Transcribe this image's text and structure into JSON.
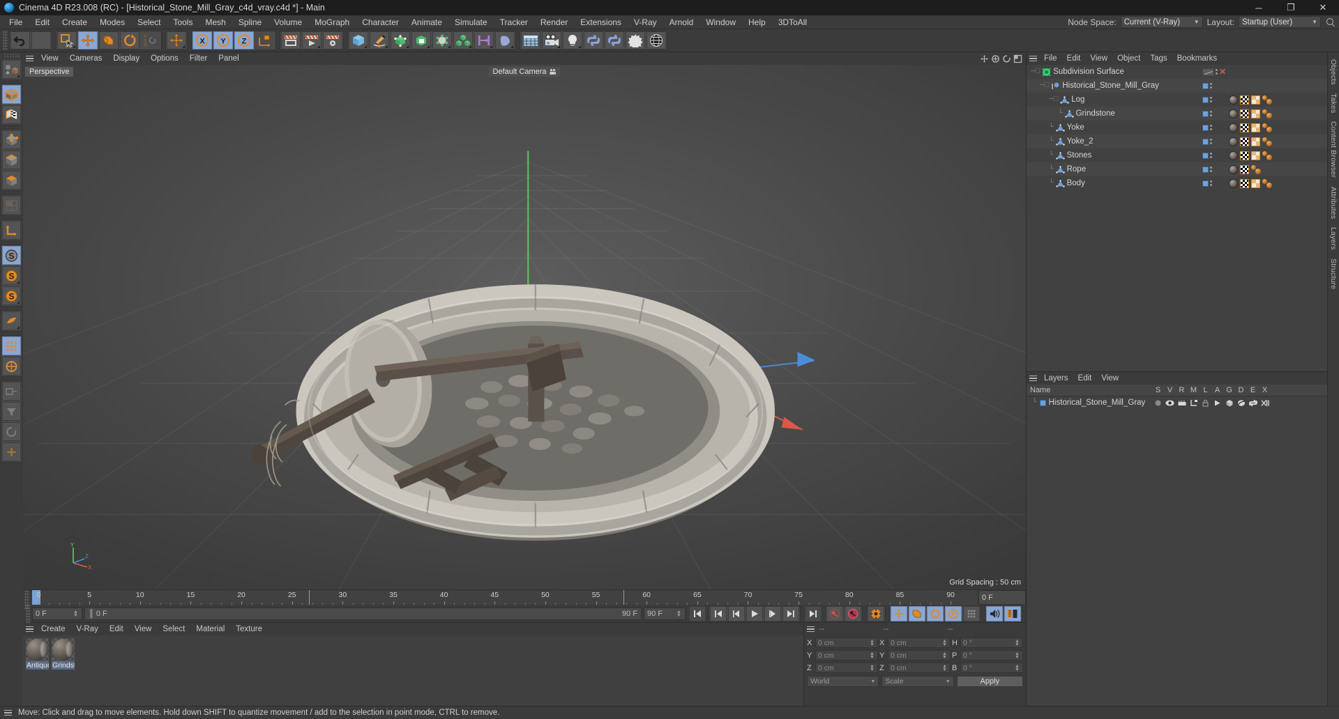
{
  "window": {
    "title": "Cinema 4D R23.008 (RC) - [Historical_Stone_Mill_Gray_c4d_vray.c4d *] - Main",
    "minimize": "─",
    "maximize": "❐",
    "close": "✕"
  },
  "menubar": {
    "items": [
      "File",
      "Edit",
      "Create",
      "Modes",
      "Select",
      "Tools",
      "Mesh",
      "Spline",
      "Volume",
      "MoGraph",
      "Character",
      "Animate",
      "Simulate",
      "Tracker",
      "Render",
      "Extensions",
      "V-Ray",
      "Arnold",
      "Window",
      "Help",
      "3DToAll"
    ],
    "node_space_label": "Node Space:",
    "node_space_value": "Current (V-Ray)",
    "layout_label": "Layout:",
    "layout_value": "Startup (User)"
  },
  "viewport": {
    "menu": [
      "View",
      "Cameras",
      "Display",
      "Options",
      "Filter",
      "Panel"
    ],
    "projection_label": "Perspective",
    "camera_label": "Default Camera",
    "grid_spacing": "Grid Spacing : 50 cm",
    "axis_x": "X",
    "axis_y": "Y",
    "axis_z": "Z"
  },
  "timeline": {
    "ticks": [
      0,
      5,
      10,
      15,
      20,
      25,
      30,
      35,
      40,
      45,
      50,
      55,
      60,
      65,
      70,
      75,
      80,
      85,
      90
    ],
    "current_frame_left": "0 F",
    "track_start": "0 F",
    "track_end": "90 F",
    "range_end": "90 F",
    "right_frame": "0 F"
  },
  "objects": {
    "menu": [
      "File",
      "Edit",
      "View",
      "Object",
      "Tags",
      "Bookmarks"
    ],
    "rows": [
      {
        "name": "Subdivision Surface",
        "indent": 0,
        "icon": "subdivision-icon",
        "tags": [],
        "has_dash": true,
        "has_x": true,
        "swatch": false
      },
      {
        "name": "Historical_Stone_Mill_Gray",
        "indent": 1,
        "icon": "null-object-icon",
        "tags": [],
        "swatch": true
      },
      {
        "name": "Log",
        "indent": 2,
        "icon": "polygon-object-icon",
        "tags": [
          "material",
          "uv",
          "selection",
          "phong"
        ],
        "swatch": true
      },
      {
        "name": "Grindstone",
        "indent": 3,
        "icon": "polygon-object-icon",
        "tags": [
          "material",
          "uv",
          "selection",
          "phong"
        ],
        "swatch": true
      },
      {
        "name": "Yoke",
        "indent": 2,
        "icon": "polygon-object-icon",
        "tags": [
          "material",
          "uv",
          "selection",
          "phong"
        ],
        "swatch": true
      },
      {
        "name": "Yoke_2",
        "indent": 2,
        "icon": "polygon-object-icon",
        "tags": [
          "material",
          "uv",
          "selection",
          "phong"
        ],
        "swatch": true
      },
      {
        "name": "Stones",
        "indent": 2,
        "icon": "polygon-object-icon",
        "tags": [
          "material",
          "uv",
          "selection",
          "phong"
        ],
        "swatch": true
      },
      {
        "name": "Rope",
        "indent": 2,
        "icon": "polygon-object-icon",
        "tags": [
          "material",
          "uv",
          "phong"
        ],
        "swatch": true
      },
      {
        "name": "Body",
        "indent": 2,
        "icon": "polygon-object-icon",
        "tags": [
          "material",
          "uv",
          "selection",
          "phong"
        ],
        "swatch": true
      }
    ]
  },
  "layers": {
    "menu": [
      "Layers",
      "Edit",
      "View"
    ],
    "columns": [
      "Name",
      "S",
      "V",
      "R",
      "M",
      "L",
      "A",
      "G",
      "D",
      "E",
      "X"
    ],
    "rows": [
      {
        "name": "Historical_Stone_Mill_Gray",
        "color": "#6ea2d8"
      }
    ]
  },
  "materials": {
    "menu": [
      "Create",
      "V-Ray",
      "Edit",
      "View",
      "Select",
      "Material",
      "Texture"
    ],
    "items": [
      {
        "name": "Antique_"
      },
      {
        "name": "Grindsto"
      }
    ]
  },
  "coordinates": {
    "headers": [
      "--",
      "--",
      "--"
    ],
    "position": {
      "x": "0 cm",
      "y": "0 cm",
      "z": "0 cm"
    },
    "size": {
      "x": "0 cm",
      "y": "0 cm",
      "z": "0 cm"
    },
    "rotation": {
      "h": "0 °",
      "p": "0 °",
      "b": "0 °"
    },
    "labels": {
      "x": "X",
      "y": "Y",
      "z": "Z",
      "h": "H",
      "p": "P",
      "b": "B"
    },
    "space": "World",
    "mode": "Scale",
    "apply": "Apply"
  },
  "sidetabs": [
    "Objects",
    "Takes",
    "Content Browser",
    "Attributes",
    "Layers",
    "Structure"
  ],
  "statusbar": {
    "message": "Move: Click and drag to move elements. Hold down SHIFT to quantize movement / add to the selection in point mode, CTRL to remove."
  },
  "colors": {
    "accent_blue": "#8aa7d4",
    "orange": "#e08a2a",
    "panel": "#3b3b3b",
    "list": "#414141",
    "green_axis": "#5ad25a",
    "red_axis": "#e05a4a",
    "blue_axis": "#4a8fe0"
  }
}
